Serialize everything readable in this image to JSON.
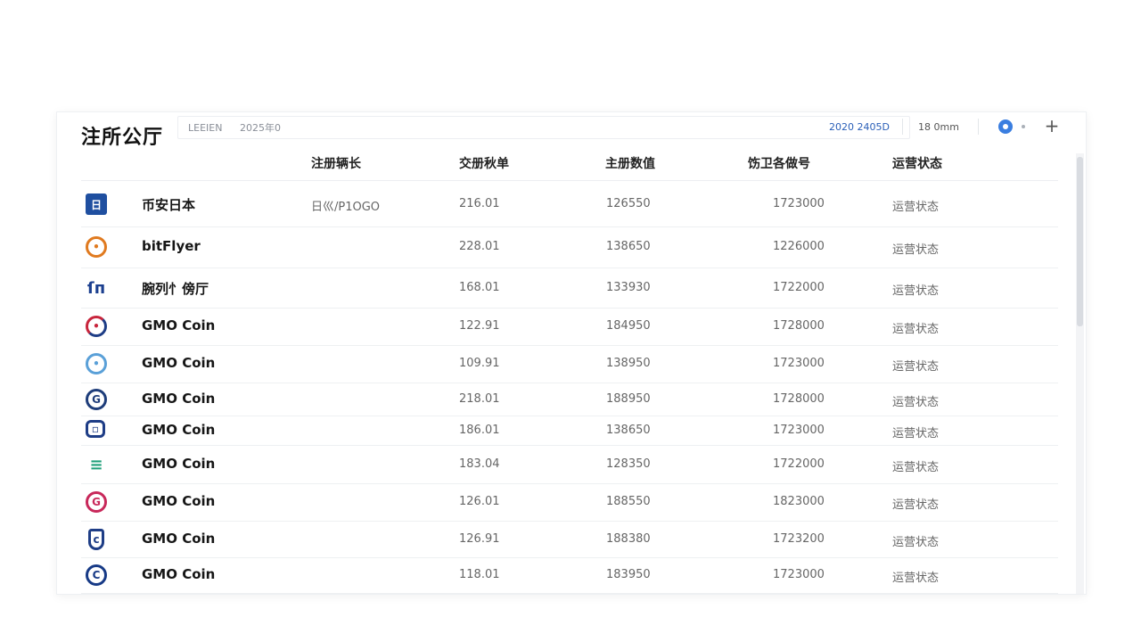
{
  "page": {
    "title": "注所公厅",
    "meta_fields": [
      "LEEIEN",
      "2025年0"
    ],
    "meta_date": "2020 2405D",
    "meta_size": "18 0mm"
  },
  "table": {
    "columns": [
      "注册辆长",
      "交册秋单",
      "主册数值",
      "饬卫各做号",
      "运营状态"
    ],
    "rows": [
      {
        "name": "币安日本",
        "icon": "square-logo-icon",
        "color": "#1f4fa0",
        "reg": "日巛/P1OGO",
        "v1": "216.01",
        "v2": "126550",
        "v3": "1723000",
        "status": "运营状态"
      },
      {
        "name": "bitFlyer",
        "icon": "orange-ring-logo-icon",
        "color": "#e07a1f",
        "reg": "",
        "v1": "228.01",
        "v2": "138650",
        "v3": "1226000",
        "status": "运营状态"
      },
      {
        "name": "腕列忄傍厅",
        "icon": "fp-logo-icon",
        "color": "#1b3f8f",
        "reg": "",
        "v1": "168.01",
        "v2": "133930",
        "v3": "1722000",
        "status": "运营状态"
      },
      {
        "name": "GMO Coin",
        "icon": "red-blue-ring-logo-icon",
        "color": "#c8253c",
        "reg": "",
        "v1": "122.91",
        "v2": "184950",
        "v3": "1728000",
        "status": "运营状态"
      },
      {
        "name": "GMO Coin",
        "icon": "light-blue-ring-logo-icon",
        "color": "#5aa0d8",
        "reg": "",
        "v1": "109.91",
        "v2": "138950",
        "v3": "1723000",
        "status": "运营状态"
      },
      {
        "name": "GMO Coin",
        "icon": "navy-g-logo-icon",
        "color": "#1e3d7a",
        "reg": "",
        "v1": "218.01",
        "v2": "188950",
        "v3": "1728000",
        "status": "运营状态"
      },
      {
        "name": "GMO Coin",
        "icon": "navy-square-logo-icon",
        "color": "#1e3d86",
        "reg": "",
        "v1": "186.01",
        "v2": "138650",
        "v3": "1723000",
        "status": "运营状态"
      },
      {
        "name": "GMO Coin",
        "icon": "green-stack-logo-icon",
        "color": "#1fa07a",
        "reg": "",
        "v1": "183.04",
        "v2": "128350",
        "v3": "1722000",
        "status": "运营状态"
      },
      {
        "name": "GMO Coin",
        "icon": "red-g-logo-icon",
        "color": "#c8285a",
        "reg": "",
        "v1": "126.01",
        "v2": "188550",
        "v3": "1823000",
        "status": "运营状态"
      },
      {
        "name": "GMO Coin",
        "icon": "navy-shield-logo-icon",
        "color": "#1e3d86",
        "reg": "",
        "v1": "126.91",
        "v2": "188380",
        "v3": "1723200",
        "status": "运营状态"
      },
      {
        "name": "GMO Coin",
        "icon": "navy-c-logo-icon",
        "color": "#173a86",
        "reg": "",
        "v1": "118.01",
        "v2": "183950",
        "v3": "1723000",
        "status": "运营状态"
      }
    ]
  }
}
